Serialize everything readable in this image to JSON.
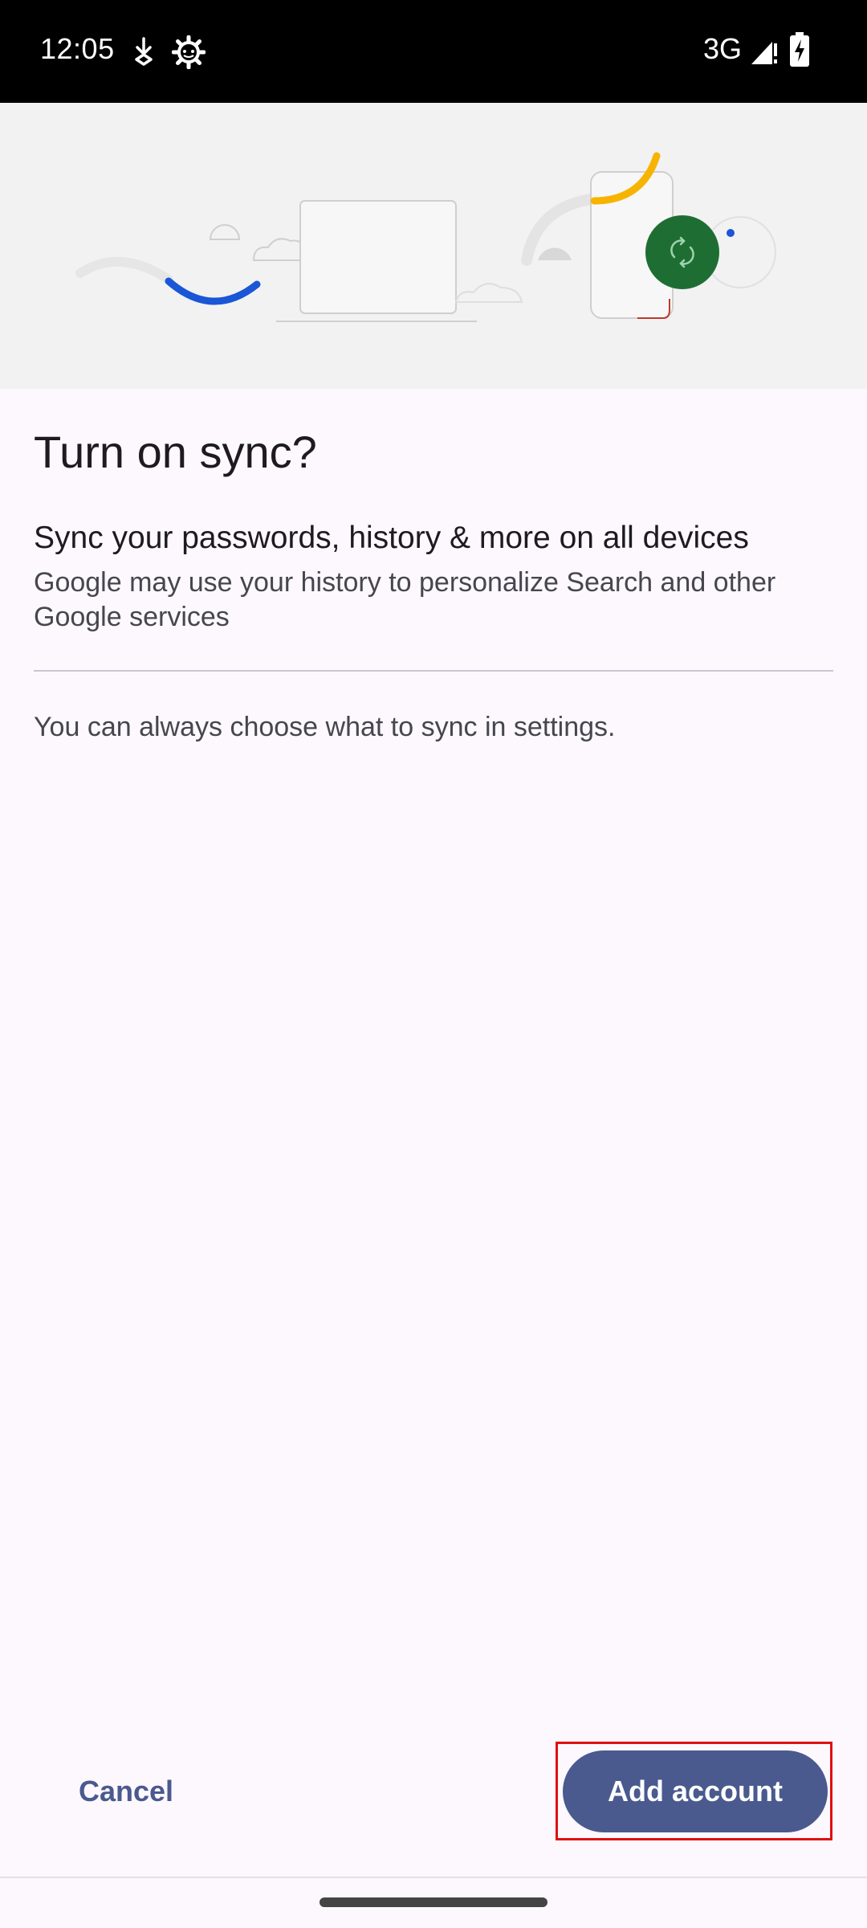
{
  "status_bar": {
    "time": "12:05",
    "network": "3G",
    "icons": [
      "download-icon",
      "settings-icon",
      "signal-icon",
      "battery-charging-icon"
    ]
  },
  "dialog": {
    "title": "Turn on sync?",
    "subtitle": "Sync your passwords, history & more on all devices",
    "description": "Google may use your history to personalize Search and other Google services",
    "settings_note": "You can always choose what to sync in settings."
  },
  "actions": {
    "cancel_label": "Cancel",
    "add_account_label": "Add account"
  },
  "colors": {
    "primary": "#4a5a8f",
    "hero_bg": "#f2f2f2",
    "sync_green": "#1e6e34",
    "accent_blue": "#1a56d6",
    "accent_yellow": "#f6b400",
    "accent_red": "#c0392b",
    "highlight_red": "#e01010"
  }
}
